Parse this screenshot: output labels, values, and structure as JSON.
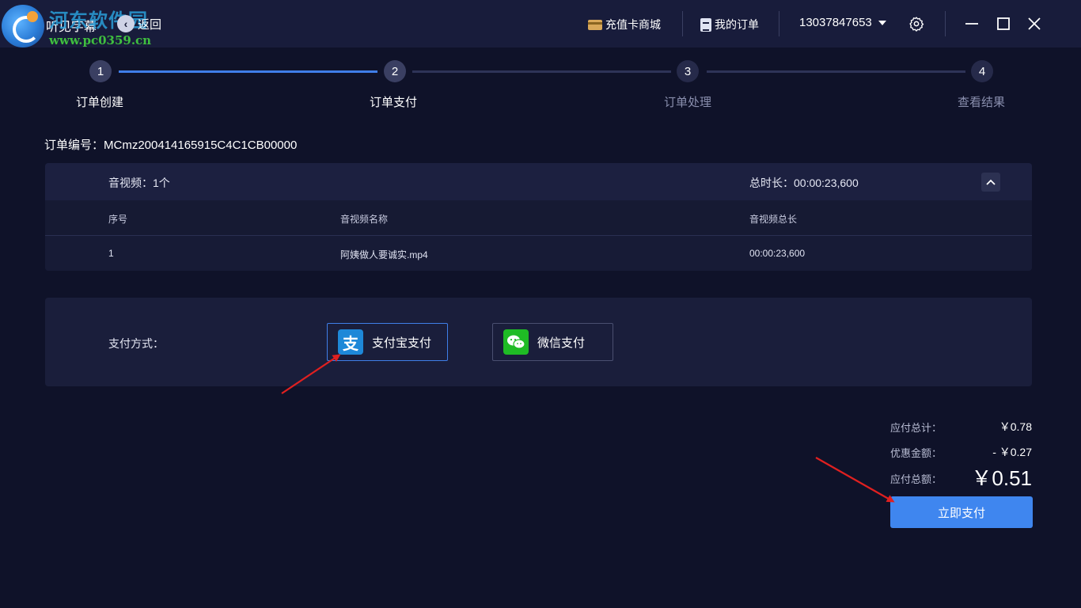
{
  "titlebar": {
    "watermark_text": "河东软件园",
    "watermark_url": "www.pc0359.cn",
    "app_title": "听见字幕",
    "back_label": "返回",
    "recharge_label": "充值卡商城",
    "orders_label": "我的订单",
    "phone": "13037847653"
  },
  "steps": [
    {
      "num": "1",
      "label": "订单创建",
      "active": true
    },
    {
      "num": "2",
      "label": "订单支付",
      "active": true
    },
    {
      "num": "3",
      "label": "订单处理",
      "active": false
    },
    {
      "num": "4",
      "label": "查看结果",
      "active": false
    }
  ],
  "order": {
    "number_label": "订单编号：MCmz200414165915C4C1CB00000"
  },
  "files": {
    "count_label": "音视频：1个",
    "duration_label": "总时长：00:00:23,600",
    "columns": [
      "序号",
      "音视频名称",
      "音视频总长"
    ],
    "rows": [
      [
        "1",
        "阿姨做人要诚实.mp4",
        "00:00:23,600"
      ]
    ]
  },
  "payment": {
    "label": "支付方式：",
    "options": [
      {
        "label": "支付宝支付",
        "icon": "alipay-icon",
        "selected": true
      },
      {
        "label": "微信支付",
        "icon": "wechat-icon",
        "selected": false
      }
    ]
  },
  "summary": {
    "subtotal_label": "应付总计：",
    "subtotal_value": "￥0.78",
    "discount_label": "优惠金额：",
    "discount_value": "- ￥0.27",
    "total_label": "应付总额：",
    "total_value": "￥0.51",
    "pay_button": "立即支付"
  },
  "colors": {
    "accent": "#3f86ef",
    "background": "#0f1229",
    "panel": "#1a1e3b",
    "alipay": "#1e88d8",
    "wechat": "#1fbb25",
    "annotation_arrow": "#e02020"
  }
}
